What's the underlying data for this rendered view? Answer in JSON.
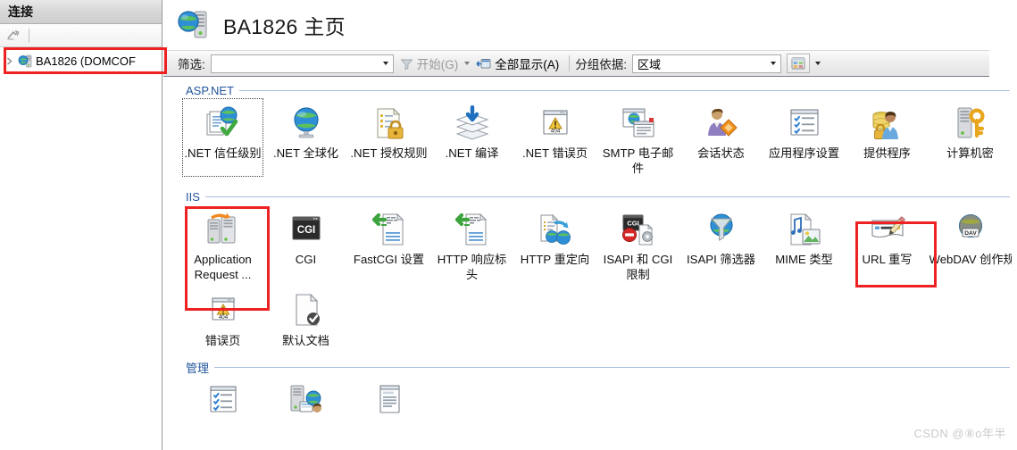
{
  "connections": {
    "title": "连接",
    "toolbar": {
      "connect_icon": "connect-to-server-icon"
    },
    "tree": {
      "node_label": "BA1826 (DOMCOF",
      "expander_icon": "chevron-right-icon",
      "node_icon": "server-globe-icon"
    }
  },
  "header": {
    "icon": "server-globe-icon",
    "title": "BA1826 主页"
  },
  "filterbar": {
    "filter_label": "筛选:",
    "filter_value": "",
    "filter_placeholder": "",
    "dropdown_icon": "chevron-down-icon",
    "go_label": "开始(G)",
    "go_icon": "funnel-icon",
    "go_caret_icon": "chevron-down-icon",
    "showall_label": "全部显示(A)",
    "showall_icon": "show-all-icon",
    "groupby_label": "分组依据:",
    "groupby_value": "区域",
    "groupby_dropdown_icon": "chevron-down-icon",
    "view_icon": "view-mode-icon",
    "view_caret_icon": "chevron-down-icon"
  },
  "board": {
    "groups": [
      {
        "name": "ASP.NET",
        "rows": [
          [
            {
              "label": ".NET 信任级别",
              "icon": "dotnet-trust-levels-icon",
              "focused": true
            },
            {
              "label": ".NET 全球化",
              "icon": "dotnet-globalization-icon"
            },
            {
              "label": ".NET 授权规则",
              "icon": "dotnet-authorization-rules-icon"
            },
            {
              "label": ".NET 编译",
              "icon": "dotnet-compilation-icon"
            },
            {
              "label": ".NET 错误页",
              "icon": "dotnet-error-pages-icon"
            },
            {
              "label": "SMTP 电子邮件",
              "icon": "smtp-email-icon"
            },
            {
              "label": "会话状态",
              "icon": "session-state-icon"
            },
            {
              "label": "应用程序设置",
              "icon": "application-settings-icon"
            },
            {
              "label": "提供程序",
              "icon": "providers-icon"
            },
            {
              "label": "计算机密",
              "icon": "machine-key-icon",
              "clipped": true
            }
          ]
        ]
      },
      {
        "name": "IIS",
        "rows": [
          [
            {
              "label": "Application Request ...",
              "icon": "application-request-routing-icon",
              "highlighted": true
            },
            {
              "label": "CGI",
              "icon": "cgi-icon"
            },
            {
              "label": "FastCGI 设置",
              "icon": "fastcgi-settings-icon"
            },
            {
              "label": "HTTP 响应标头",
              "icon": "http-response-headers-icon"
            },
            {
              "label": "HTTP 重定向",
              "icon": "http-redirect-icon"
            },
            {
              "label": "ISAPI 和 CGI 限制",
              "icon": "isapi-cgi-restrictions-icon"
            },
            {
              "label": "ISAPI 筛选器",
              "icon": "isapi-filters-icon"
            },
            {
              "label": "MIME 类型",
              "icon": "mime-types-icon"
            },
            {
              "label": "URL 重写",
              "icon": "url-rewrite-icon",
              "highlighted": true
            },
            {
              "label": "WebDAV 创作规",
              "icon": "webdav-authoring-rules-icon",
              "clipped": true
            }
          ],
          [
            {
              "label": "错误页",
              "icon": "error-pages-icon"
            },
            {
              "label": "默认文档",
              "icon": "default-document-icon"
            }
          ]
        ]
      },
      {
        "name": "管理",
        "rows": [
          [
            {
              "label": "",
              "icon": "configuration-editor-icon"
            },
            {
              "label": "",
              "icon": "shared-configuration-icon"
            },
            {
              "label": "",
              "icon": "feature-delegation-icon"
            }
          ]
        ]
      }
    ]
  },
  "watermark": "CSDN @⑧o年半",
  "colors": {
    "annotation": "#ee2222",
    "group_heading": "#22559c",
    "group_rule": "#a8c0dd"
  }
}
